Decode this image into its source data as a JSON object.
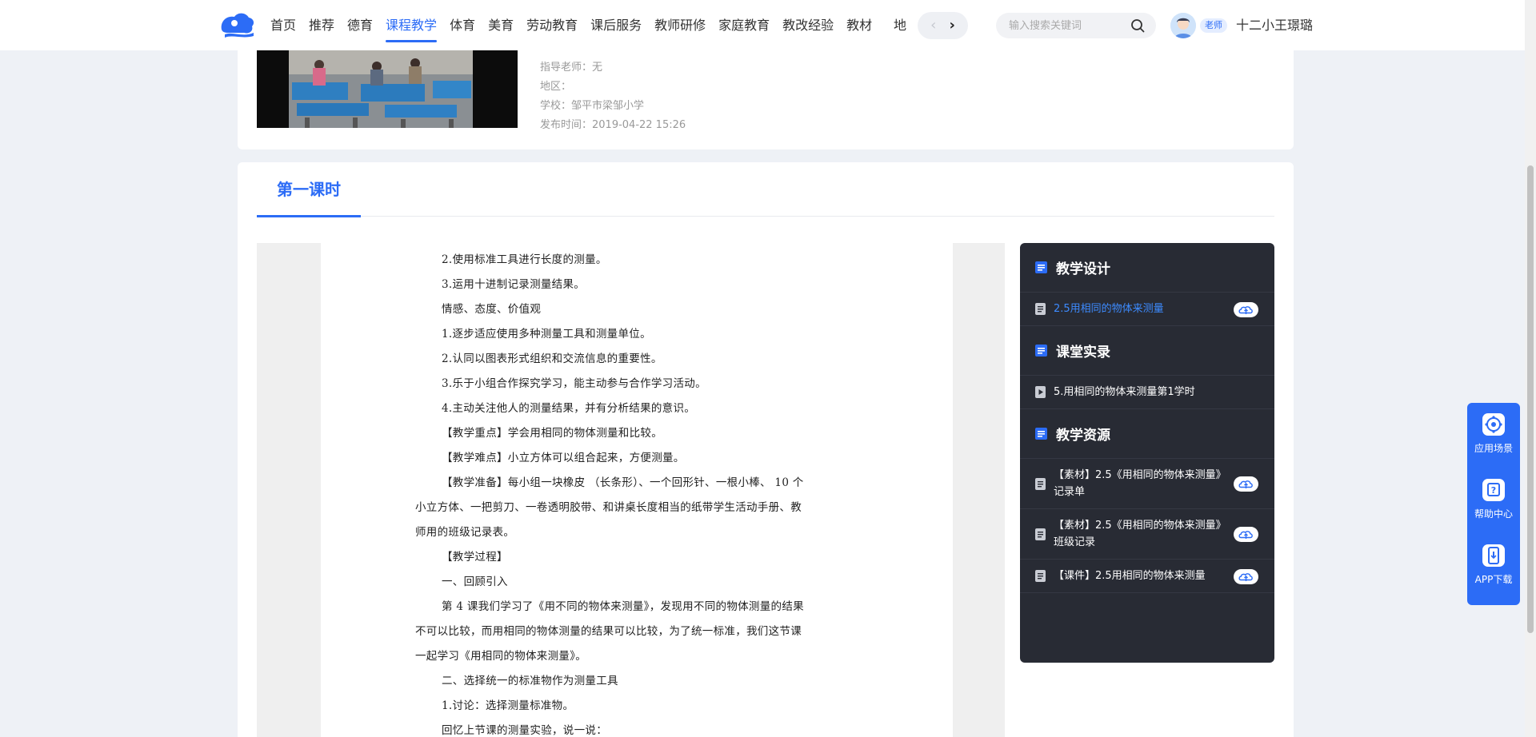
{
  "nav": {
    "items": [
      "首页",
      "推荐",
      "德育",
      "课程教学",
      "体育",
      "美育",
      "劳动教育",
      "课后服务",
      "教师研修",
      "家庭教育",
      "教改经验",
      "教材"
    ],
    "active_index": 3,
    "clipped_item": "地"
  },
  "search": {
    "placeholder": "输入搜索关键词"
  },
  "user": {
    "role": "老师",
    "name": "十二小王璟璐"
  },
  "info": {
    "teacher": "指导老师：无",
    "region": "地区：",
    "school": "学校：邹平市梁邹小学",
    "published": "发布时间：2019-04-22 15:26"
  },
  "tab": {
    "label": "第一课时"
  },
  "document": {
    "lines": [
      {
        "t": "2.使用标准工具进行长度的测量。",
        "ind": true
      },
      {
        "t": "3.运用十进制记录测量结果。",
        "ind": true
      },
      {
        "t": "情感、态度、价值观",
        "ind": true
      },
      {
        "t": "1.逐步适应使用多种测量工具和测量单位。",
        "ind": true
      },
      {
        "t": "2.认同以图表形式组织和交流信息的重要性。",
        "ind": true
      },
      {
        "t": "3.乐于小组合作探究学习，能主动参与合作学习活动。",
        "ind": true
      },
      {
        "t": "4.主动关注他人的测量结果，并有分析结果的意识。",
        "ind": true
      },
      {
        "t": "【教学重点】学会用相同的物体测量和比较。",
        "ind": true
      },
      {
        "t": "【教学难点】小立方体可以组合起来，方便测量。",
        "ind": true
      },
      {
        "t": "【教学准备】每小组一块橡皮 （长条形）、一个回形针、一根小棒、 10 个",
        "ind": true
      },
      {
        "t": "小立方体、一把剪刀、一卷透明胶带、和讲桌长度相当的纸带学生活动手册、教",
        "ind": false
      },
      {
        "t": "师用的班级记录表。",
        "ind": false
      },
      {
        "t": "【教学过程】",
        "ind": true
      },
      {
        "t": "一、回顾引入",
        "ind": true
      },
      {
        "t": "第 4 课我们学习了《用不同的物体来测量》，发现用不同的物体测量的结果",
        "ind": true
      },
      {
        "t": "不可以比较，而用相同的物体测量的结果可以比较，为了统一标准，我们这节课",
        "ind": false
      },
      {
        "t": "一起学习《用相同的物体来测量》。",
        "ind": false
      },
      {
        "t": "二、选择统一的标准物作为测量工具",
        "ind": true
      },
      {
        "t": "1.讨论：选择测量标准物。",
        "ind": true
      },
      {
        "t": "回忆上节课的测量实验，说一说：",
        "ind": true
      }
    ]
  },
  "panel": {
    "sections": [
      {
        "title": "教学设计",
        "items": [
          {
            "text": "2.5用相同的物体来测量",
            "type": "doc",
            "link": true,
            "download": true
          }
        ]
      },
      {
        "title": "课堂实录",
        "items": [
          {
            "text": "5.用相同的物体来测量第1学时",
            "type": "video",
            "link": false,
            "download": false
          }
        ]
      },
      {
        "title": "教学资源",
        "items": [
          {
            "text": "【素材】2.5《用相同的物体来测量》记录单",
            "type": "doc",
            "link": false,
            "download": true
          },
          {
            "text": "【素材】2.5《用相同的物体来测量》班级记录",
            "type": "doc",
            "link": false,
            "download": true
          },
          {
            "text": "【课件】2.5用相同的物体来测量",
            "type": "doc",
            "link": false,
            "download": true
          }
        ]
      }
    ]
  },
  "float_tools": [
    "应用场景",
    "帮助中心",
    "APP下载"
  ],
  "colors": {
    "accent": "#2c6cf6",
    "panel_bg": "#282b34",
    "link": "#3d8bff"
  }
}
